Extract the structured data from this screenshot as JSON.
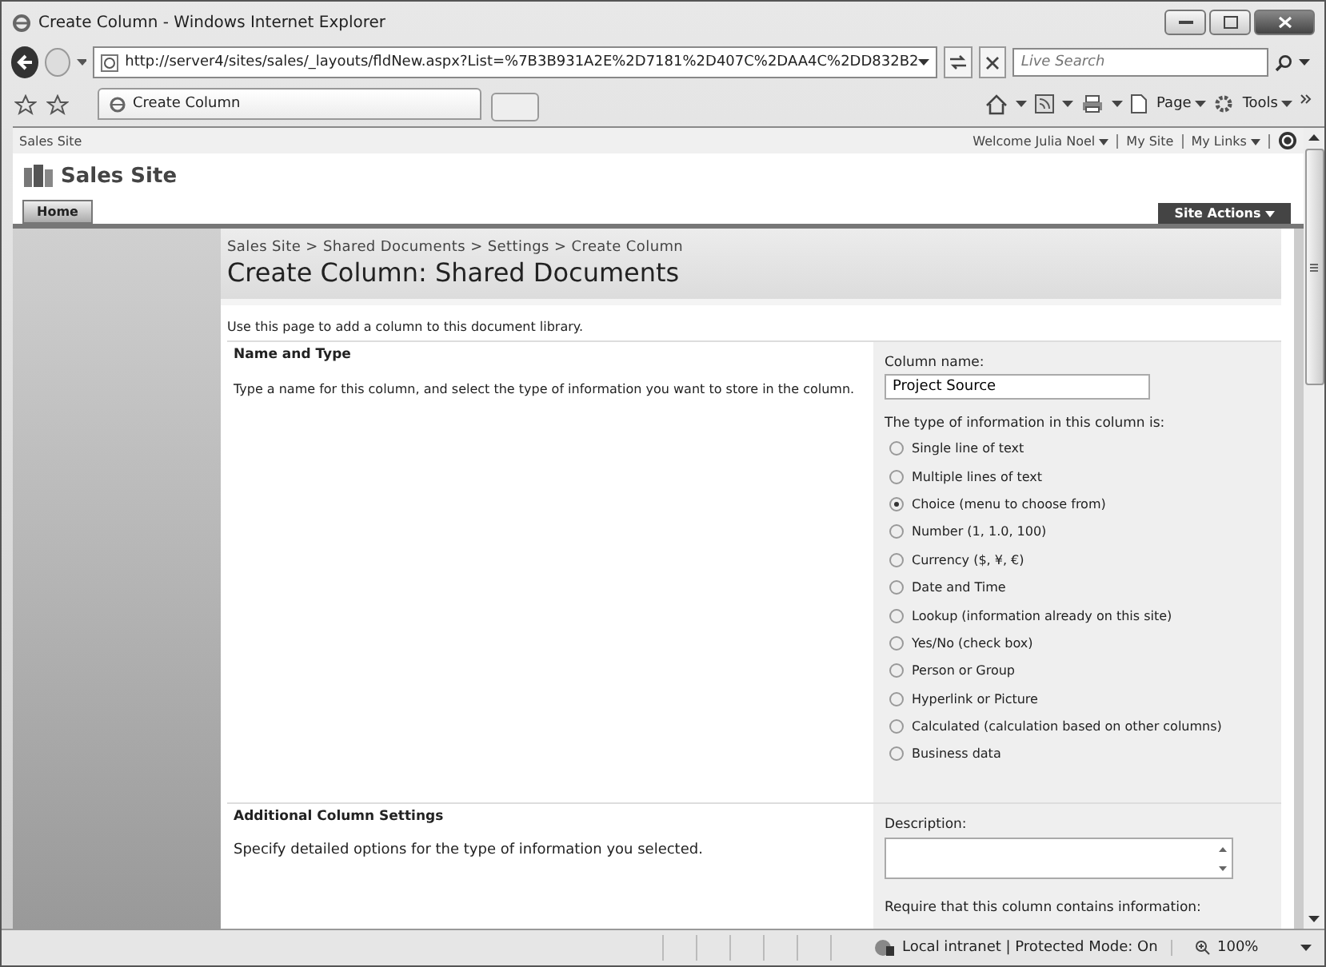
{
  "window": {
    "title": "Create Column - Windows Internet Explorer"
  },
  "address_bar": {
    "url": "http://server4/sites/sales/_layouts/fldNew.aspx?List=%7B3B931A2E%2D7181%2D407C%2DAA4C%2DD832B2",
    "search_placeholder": "Live Search"
  },
  "tabs": [
    {
      "label": "Create Column",
      "selected": true
    }
  ],
  "command_bar": {
    "page": "Page",
    "tools": "Tools"
  },
  "site": {
    "top_link": "Sales Site",
    "welcome": "Welcome Julia Noel",
    "my_site": "My Site",
    "my_links": "My Links",
    "title": "Sales Site",
    "nav": [
      {
        "label": "Home",
        "selected": true
      }
    ],
    "site_actions": "Site Actions"
  },
  "breadcrumb": "Sales Site > Shared Documents > Settings > Create Column",
  "page_title": "Create Column: Shared Documents",
  "intro": "Use this page to add a column to this document library.",
  "sections": [
    {
      "title": "Name and Type",
      "description": "Type a name for this column, and select the type of information you want to store in the column.",
      "field_label": "Column name:",
      "field_value": "Project Source",
      "kind": "name-type",
      "type_label": "The type of information in this column is:",
      "types": [
        {
          "label": "Single line of text",
          "selected": false
        },
        {
          "label": "Multiple lines of text",
          "selected": false
        },
        {
          "label": "Choice (menu to choose from)",
          "selected": true
        },
        {
          "label": "Number (1, 1.0, 100)",
          "selected": false
        },
        {
          "label": "Currency ($, ¥, €)",
          "selected": false
        },
        {
          "label": "Date and Time",
          "selected": false
        },
        {
          "label": "Lookup (information already on this site)",
          "selected": false
        },
        {
          "label": "Yes/No (check box)",
          "selected": false
        },
        {
          "label": "Person or Group",
          "selected": false
        },
        {
          "label": "Hyperlink or Picture",
          "selected": false
        },
        {
          "label": "Calculated (calculation based on other columns)",
          "selected": false
        },
        {
          "label": "Business data",
          "selected": false
        }
      ]
    },
    {
      "title": "Additional Column Settings",
      "description": "Specify detailed options for the type of information you selected.",
      "field_label": "Description:",
      "kind": "settings",
      "after_label": "Require that this column contains information:"
    }
  ],
  "status_bar": {
    "zone": "Local intranet | Protected Mode: On",
    "zoom": "100%"
  }
}
